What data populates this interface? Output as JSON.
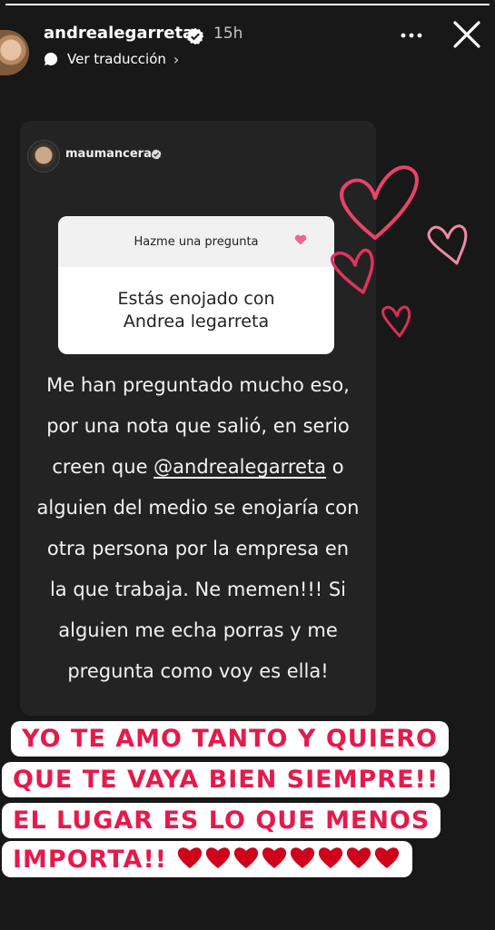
{
  "story": {
    "progress_fraction": 1.0,
    "author": "andrealegarreta",
    "time_ago": "15h",
    "translate_label": "Ver traducción",
    "translate_chevron": "›"
  },
  "shared_post": {
    "author": "maumancera",
    "question_box": {
      "header": "Hazme una pregunta",
      "question_lines": [
        "Estás enojado con",
        "Andrea legarreta"
      ]
    },
    "answer": {
      "line1": "Me han preguntado mucho eso,",
      "line2": "por una nota que salió, en serio",
      "line3_before": "creen que ",
      "mention": "@andrealegarreta",
      "line3_after": " o",
      "line4": "alguien del medio se enojaría con",
      "line5": "otra persona por la empresa en",
      "line6": "la que trabaja. Ne memen!!! Si",
      "line7": "alguien me echa porras y me",
      "line8": "pregunta como voy es ella!"
    }
  },
  "overlay_text": {
    "lines": [
      "YO TE AMO TANTO Y QUIERO",
      "QUE TE VAYA BIEN SIEMPRE!!",
      "EL LUGAR ES LO QUE MENOS",
      "IMPORTA!!"
    ],
    "heart_emoji_count": 8
  },
  "colors": {
    "background": "#181818",
    "card": "#232323",
    "overlay_text": "#e51a4c",
    "overlay_bg": "#ffffff",
    "heart_stroke": "#e8436b"
  },
  "icons": [
    "verified-badge-icon",
    "translate-icon",
    "more-options-icon",
    "close-icon",
    "heart-outline-icon",
    "red-heart-emoji-icon"
  ]
}
